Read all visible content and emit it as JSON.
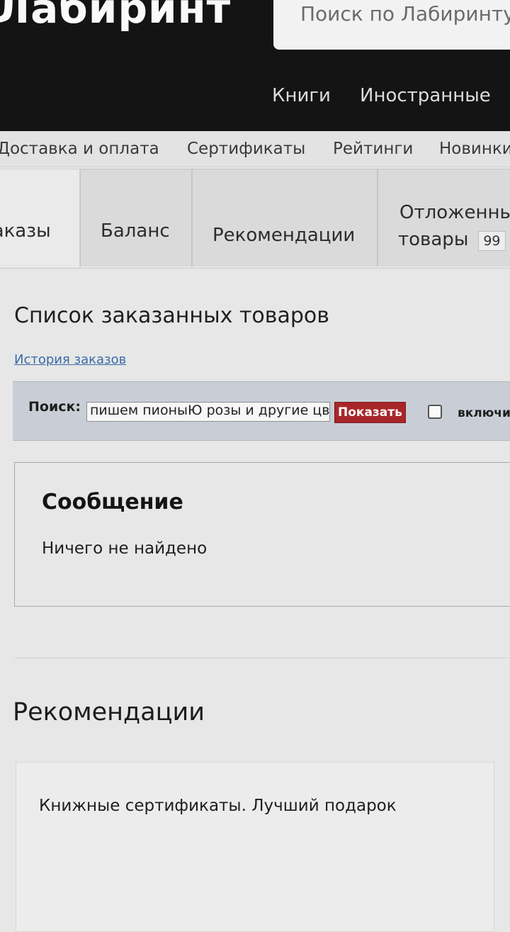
{
  "header": {
    "logo": "Лабиринт",
    "search_placeholder": "Поиск по Лабиринту",
    "nav": [
      "Книги",
      "Иностранные"
    ]
  },
  "subnav": [
    "Доставка и оплата",
    "Сертификаты",
    "Рейтинги",
    "Новинки"
  ],
  "tabs": {
    "orders": "Заказы",
    "balance": "Баланс",
    "recommendations": "Рекомендации",
    "deferred_line1": "Отложенные",
    "deferred_line2": "товары",
    "deferred_count": "99"
  },
  "page_title": "Список заказанных товаров",
  "history_link": "История заказов",
  "search": {
    "label": "Поиск:",
    "value": "пишем пионыЮ розы и другие цветы",
    "button": "Показать",
    "checkbox_label": "включить"
  },
  "message": {
    "title": "Сообщение",
    "text": "Ничего не найдено"
  },
  "recommendations": {
    "title": "Рекомендации",
    "card_text": "Книжные сертификаты. Лучший подарок"
  }
}
